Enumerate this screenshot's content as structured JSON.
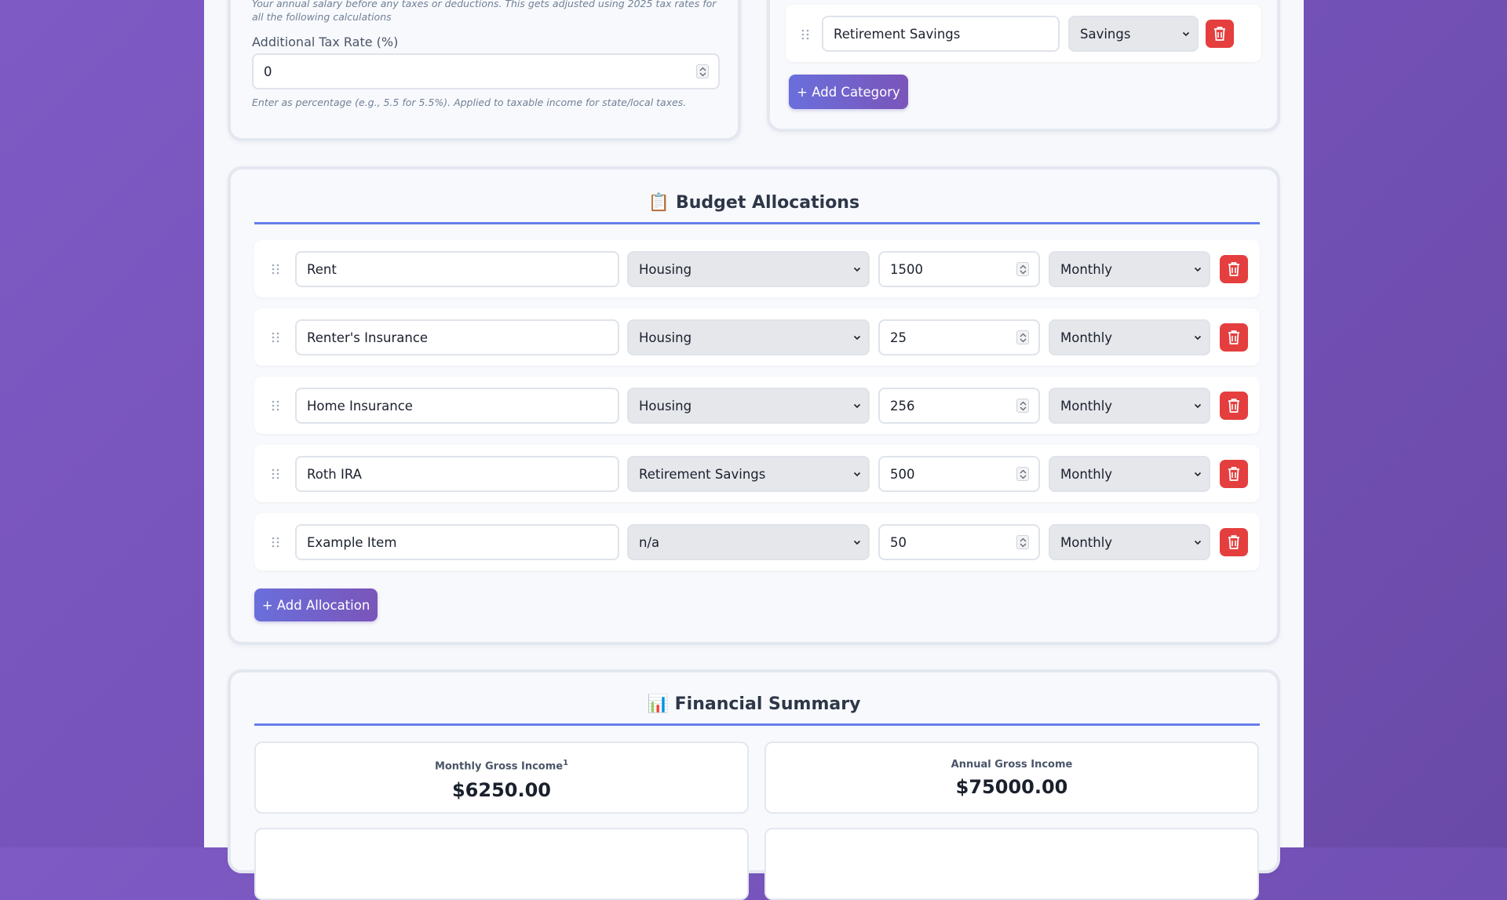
{
  "income_card": {
    "salary_hint": "Your annual salary before any taxes or deductions. This gets adjusted using 2025 tax rates for all the following calculations",
    "tax_rate_label": "Additional Tax Rate (%)",
    "tax_rate_value": "0",
    "tax_rate_hint": "Enter as percentage (e.g., 5.5 for 5.5%). Applied to taxable income for state/local taxes."
  },
  "categories_card": {
    "last_category": {
      "name": "Retirement Savings",
      "type": "Savings"
    },
    "add_button": "+ Add Category"
  },
  "allocations": {
    "icon": "📋",
    "title": "Budget Allocations",
    "items": [
      {
        "name": "Rent",
        "category": "Housing",
        "amount": "1500",
        "frequency": "Monthly"
      },
      {
        "name": "Renter's Insurance",
        "category": "Housing",
        "amount": "25",
        "frequency": "Monthly"
      },
      {
        "name": "Home Insurance",
        "category": "Housing",
        "amount": "256",
        "frequency": "Monthly"
      },
      {
        "name": "Roth IRA",
        "category": "Retirement Savings",
        "amount": "500",
        "frequency": "Monthly"
      },
      {
        "name": "Example Item",
        "category": "n/a",
        "amount": "50",
        "frequency": "Monthly"
      }
    ],
    "add_button": "+ Add Allocation"
  },
  "summary": {
    "icon": "📊",
    "title": "Financial Summary",
    "monthly_gross_label": "Monthly Gross Income",
    "monthly_gross_footnote": "1",
    "monthly_gross_value": "$6250.00",
    "annual_gross_label": "Annual Gross Income",
    "annual_gross_value": "$75000.00"
  },
  "colors": {
    "accent": "#667eea",
    "delete": "#e53e3e",
    "background_purple": "#7452b8"
  },
  "icons": {
    "drag": "drag-handle-icon",
    "delete": "trash-icon",
    "dropdown": "chevron-down-icon",
    "spinner": "number-spinner-icon"
  }
}
